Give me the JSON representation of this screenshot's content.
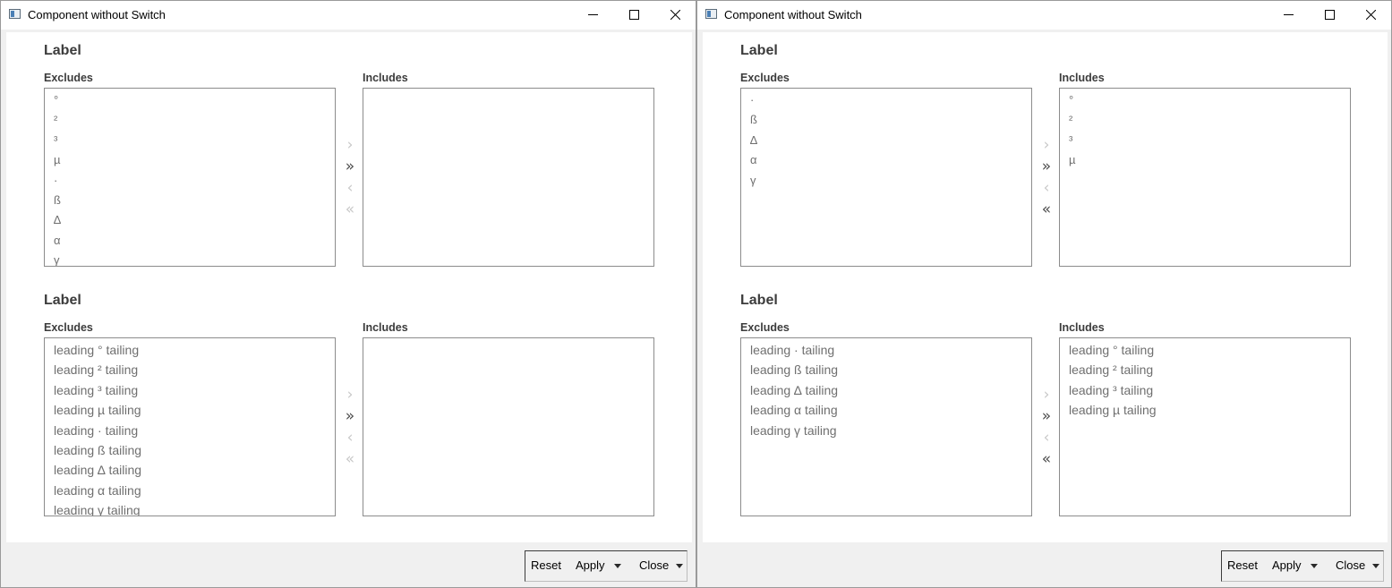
{
  "windows": [
    {
      "title": "Component without Switch",
      "sections": [
        {
          "label": "Label",
          "excludes_label": "Excludes",
          "includes_label": "Includes",
          "excludes": [
            "°",
            "²",
            "³",
            "µ",
            "·",
            "ß",
            "∆",
            "α",
            "γ"
          ],
          "includes": [],
          "symbol_list": true,
          "arrows": {
            "move_right_enabled": false,
            "move_all_right_enabled": true,
            "move_left_enabled": false,
            "move_all_left_enabled": false
          }
        },
        {
          "label": "Label",
          "excludes_label": "Excludes",
          "includes_label": "Includes",
          "excludes": [
            "leading ° tailing",
            "leading ² tailing",
            "leading ³ tailing",
            "leading µ tailing",
            "leading · tailing",
            "leading ß tailing",
            "leading ∆ tailing",
            "leading α tailing",
            "leading γ tailing"
          ],
          "includes": [],
          "symbol_list": false,
          "arrows": {
            "move_right_enabled": false,
            "move_all_right_enabled": true,
            "move_left_enabled": false,
            "move_all_left_enabled": false
          }
        }
      ],
      "buttons": {
        "reset": "Reset",
        "apply": "Apply",
        "close": "Close"
      }
    },
    {
      "title": "Component without Switch",
      "sections": [
        {
          "label": "Label",
          "excludes_label": "Excludes",
          "includes_label": "Includes",
          "excludes": [
            "·",
            "ß",
            "∆",
            "α",
            "γ"
          ],
          "includes": [
            "°",
            "²",
            "³",
            "µ"
          ],
          "symbol_list": true,
          "arrows": {
            "move_right_enabled": false,
            "move_all_right_enabled": true,
            "move_left_enabled": false,
            "move_all_left_enabled": true
          }
        },
        {
          "label": "Label",
          "excludes_label": "Excludes",
          "includes_label": "Includes",
          "excludes": [
            "leading · tailing",
            "leading ß tailing",
            "leading ∆ tailing",
            "leading α tailing",
            "leading γ tailing"
          ],
          "includes": [
            "leading ° tailing",
            "leading ² tailing",
            "leading ³ tailing",
            "leading µ tailing"
          ],
          "symbol_list": false,
          "arrows": {
            "move_right_enabled": false,
            "move_all_right_enabled": true,
            "move_left_enabled": false,
            "move_all_left_enabled": true
          }
        }
      ],
      "buttons": {
        "reset": "Reset",
        "apply": "Apply",
        "close": "Close"
      }
    }
  ],
  "icons": {
    "app": "app-window-icon",
    "minimize": "minimize-icon",
    "maximize": "maximize-icon",
    "close": "close-icon",
    "move_right": "chevron-right-icon",
    "move_all_right": "double-chevron-right-icon",
    "move_left": "chevron-left-icon",
    "move_all_left": "double-chevron-left-icon",
    "dropdown": "caret-down-icon"
  },
  "colors": {
    "disabled_arrow": "#c8c8c8",
    "enabled_arrow": "#4a4a4a",
    "list_text": "#6f6f6f",
    "label_text": "#3c3c3c"
  }
}
